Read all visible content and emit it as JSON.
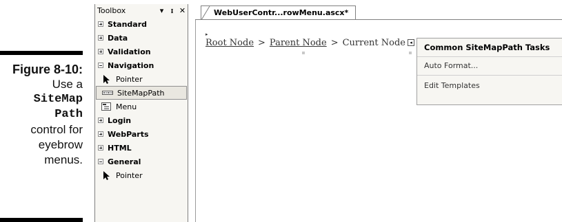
{
  "caption": {
    "figure": "Figure 8-10:",
    "line1": "Use a",
    "code1": "SiteMap",
    "code2": "Path",
    "line2": "control for",
    "line3": "eyebrow",
    "line4": "menus."
  },
  "toolbox": {
    "title": "Toolbox",
    "dropdown_glyph": "▾",
    "pin_glyph": "ᵻ",
    "close_glyph": "✕",
    "groups": {
      "standard": "Standard",
      "data": "Data",
      "validation": "Validation",
      "navigation": "Navigation",
      "login": "Login",
      "webparts": "WebParts",
      "html": "HTML",
      "general": "General"
    },
    "items": {
      "nav_pointer": "Pointer",
      "sitemappath": "SiteMapPath",
      "menu": "Menu",
      "general_pointer": "Pointer"
    }
  },
  "editor": {
    "tab_label": "WebUserContr...rowMenu.ascx*",
    "sitemap": {
      "root": "Root Node",
      "parent": "Parent Node",
      "current": "Current Node",
      "separator": ">"
    },
    "smart_tag_glyph": "◂",
    "tasks_panel": {
      "title": "Common SiteMapPath Tasks",
      "auto_format": "Auto Format...",
      "edit_templates": "Edit Templates"
    }
  },
  "colors": {
    "panel_bg": "#f7f6f2",
    "border": "#7f7f7f",
    "selected_bg": "#e9e7e0"
  }
}
